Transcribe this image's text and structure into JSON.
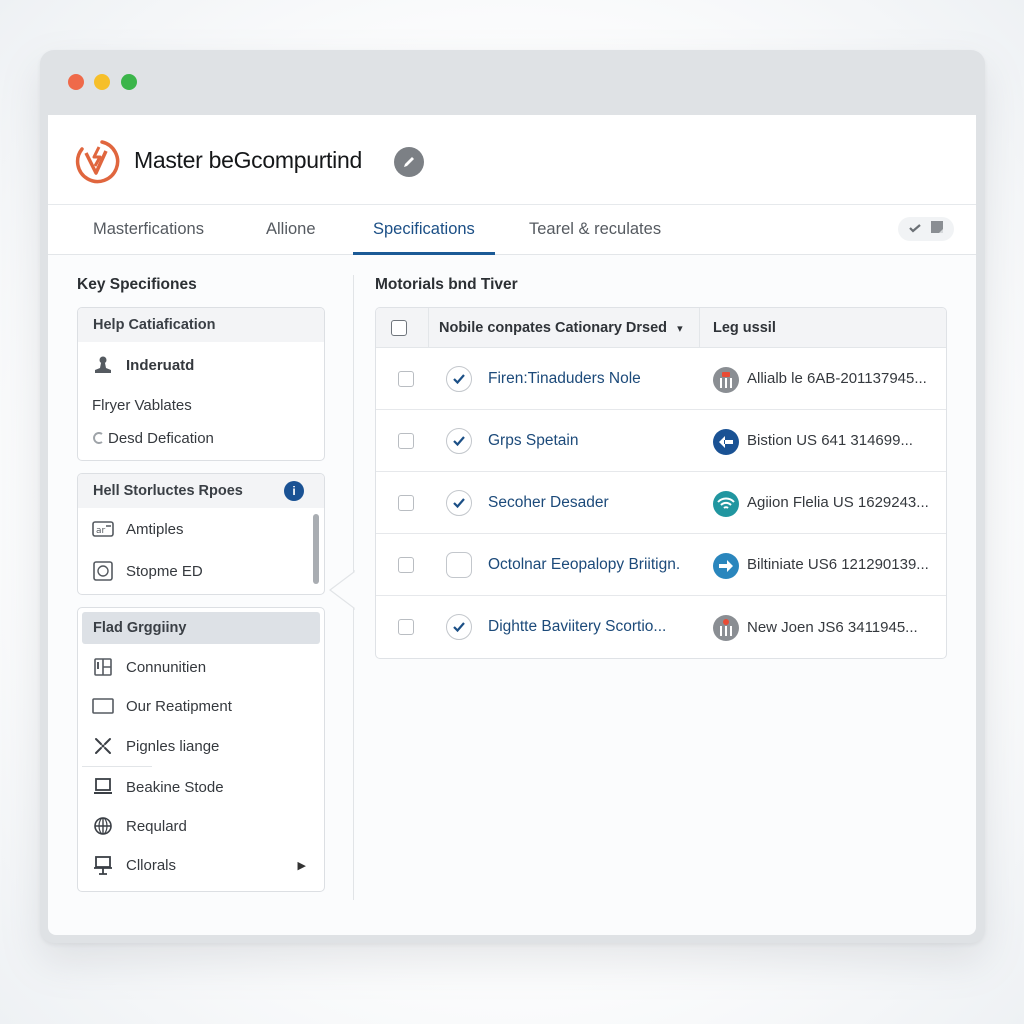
{
  "window": {
    "traffic_lights": [
      "close",
      "minimize",
      "maximize"
    ],
    "colors": {
      "close": "#ef6a4a",
      "minimize": "#f6bf2a",
      "maximize": "#3bb54a"
    }
  },
  "header": {
    "app_title": "Master beGcompurtind",
    "logo_icon": "bolt-v-circle-icon",
    "edit_icon": "pencil-icon",
    "brand_color": "#e0663e"
  },
  "tabs": [
    {
      "label": "Masterfications",
      "active": false
    },
    {
      "label": "Allione",
      "active": false
    },
    {
      "label": "Specifications",
      "active": true
    },
    {
      "label": "Tearel & reculates",
      "active": false
    }
  ],
  "tab_actions": {
    "icons": [
      "check-icon",
      "note-icon"
    ]
  },
  "left_panel": {
    "title": "Key Specifiones",
    "cards": [
      {
        "header": "Help Catiafication",
        "items": [
          {
            "label": "Inderuatd",
            "icon": "user-icon"
          },
          {
            "label": "Flryer Vablates",
            "icon": ""
          },
          {
            "label": "Desd Defication",
            "icon": "refresh-icon"
          }
        ]
      },
      {
        "header": "Hell Storluctes Rpoes",
        "badge": "i",
        "items": [
          {
            "label": "Amtiples",
            "icon": "id-card-icon"
          },
          {
            "label": "Stopme ED",
            "icon": "badge-icon"
          }
        ]
      },
      {
        "header": "Flad Grggiiny",
        "items": [
          {
            "label": "Connunitien",
            "icon": "book-icon"
          },
          {
            "label": "Our Reatipment",
            "icon": "rectangle-icon"
          },
          {
            "label": "Pignles liange",
            "icon": "scatter-icon"
          },
          {
            "label": "Beakine Stode",
            "icon": "laptop-icon"
          },
          {
            "label": "Requlard",
            "icon": "globe-icon"
          },
          {
            "label": "Cllorals",
            "icon": "presentation-icon",
            "has_submenu": true
          }
        ]
      }
    ]
  },
  "right_panel": {
    "title": "Motorials bnd Tiver",
    "table": {
      "columns": [
        "Nobile conpates Cationary Drsed",
        "Leg ussil"
      ],
      "sort_indicator": "▾",
      "rows": [
        {
          "selected": false,
          "checked": true,
          "name": "Firen:Tinaduders Nole",
          "icon": "grid-red-dot-icon",
          "icon_color": "#8a8e93",
          "value": "Allialb le 6AB-201137945..."
        },
        {
          "selected": false,
          "checked": true,
          "name": "Grps Spetain",
          "icon": "arrow-left-icon",
          "icon_color": "#1a5294",
          "value": "Bistion US 641 314699..."
        },
        {
          "selected": false,
          "checked": true,
          "name": "Secoher Desader",
          "icon": "wifi-icon",
          "icon_color": "#2196a0",
          "value": "Agiion Flelia US 1629243..."
        },
        {
          "selected": false,
          "checked": false,
          "name": "Octolnar Eeopalopy Briitign.",
          "icon": "arrow-right-icon",
          "icon_color": "#2a86bd",
          "value": "Biltiniate US6 121290139..."
        },
        {
          "selected": false,
          "checked": true,
          "name": "Dightte Baviitery Scortio...",
          "icon": "grid-red-dot-icon",
          "icon_color": "#8a8e93",
          "value": "New Joen JS6 3411945..."
        }
      ]
    }
  }
}
